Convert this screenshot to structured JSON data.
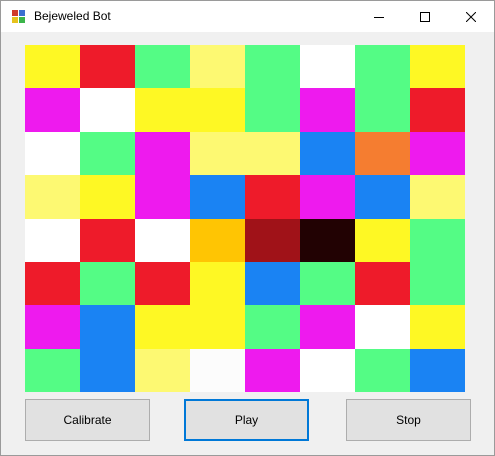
{
  "window": {
    "title": "Bejeweled Bot"
  },
  "colors": {
    "Y": "#fef824",
    "R": "#ee1b2a",
    "G": "#54fc85",
    "L": "#fdf972",
    "W": "#ffffff",
    "M": "#ee1aee",
    "B": "#1a83f3",
    "O": "#f57d30",
    "A": "#ffc503",
    "D": "#a01218",
    "K": "#220203",
    "F": "#fcfcfc"
  },
  "board": [
    [
      "Y",
      "R",
      "G",
      "L",
      "G",
      "W",
      "G",
      "Y"
    ],
    [
      "M",
      "W",
      "Y",
      "Y",
      "G",
      "M",
      "G",
      "R"
    ],
    [
      "W",
      "G",
      "M",
      "L",
      "L",
      "B",
      "O",
      "M"
    ],
    [
      "L",
      "Y",
      "M",
      "B",
      "R",
      "M",
      "B",
      "L"
    ],
    [
      "W",
      "R",
      "W",
      "A",
      "D",
      "K",
      "Y",
      "G"
    ],
    [
      "R",
      "G",
      "R",
      "Y",
      "B",
      "G",
      "R",
      "G"
    ],
    [
      "M",
      "B",
      "Y",
      "Y",
      "G",
      "M",
      "W",
      "Y"
    ],
    [
      "G",
      "B",
      "L",
      "F",
      "M",
      "W",
      "G",
      "B"
    ]
  ],
  "buttons": {
    "calibrate": "Calibrate",
    "play": "Play",
    "stop": "Stop"
  }
}
